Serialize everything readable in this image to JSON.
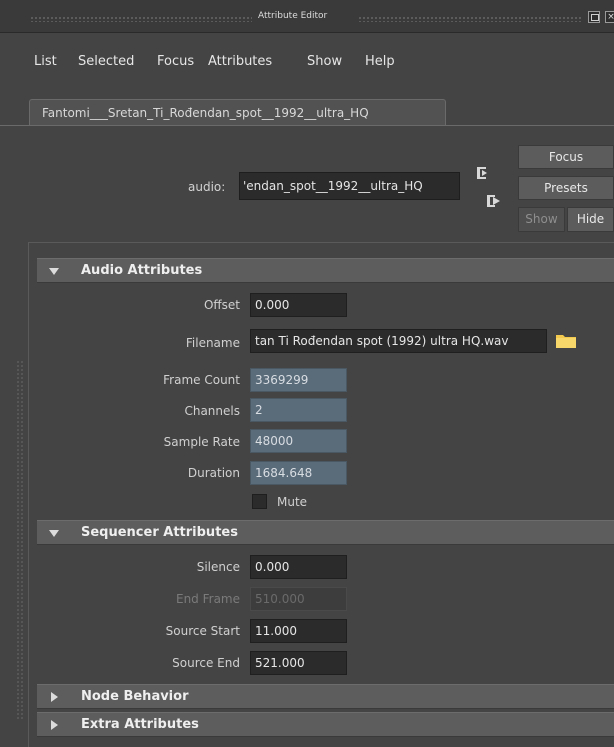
{
  "window": {
    "title": "Attribute Editor"
  },
  "menu": [
    "List",
    "Selected",
    "Focus",
    "Attributes",
    "Show",
    "Help"
  ],
  "tab": {
    "label": "Fantomi___Sretan_Ti_Rođendan_spot__1992__ultra_HQ"
  },
  "node": {
    "label": "audio:",
    "value": "'endan_spot__1992__ultra_HQ"
  },
  "buttons": {
    "focus": "Focus",
    "presets": "Presets",
    "show": "Show",
    "hide": "Hide"
  },
  "sections": {
    "audio": {
      "title": "Audio Attributes",
      "offset": {
        "label": "Offset",
        "value": "0.000"
      },
      "filename": {
        "label": "Filename",
        "value": "tan Ti Rođendan spot (1992) ultra HQ.wav"
      },
      "frame_count": {
        "label": "Frame Count",
        "value": "3369299"
      },
      "channels": {
        "label": "Channels",
        "value": "2"
      },
      "sample_rate": {
        "label": "Sample Rate",
        "value": "48000"
      },
      "duration": {
        "label": "Duration",
        "value": "1684.648"
      },
      "mute": {
        "label": "Mute",
        "checked": false
      }
    },
    "sequencer": {
      "title": "Sequencer Attributes",
      "silence": {
        "label": "Silence",
        "value": "0.000"
      },
      "end_frame": {
        "label": "End Frame",
        "value": "510.000"
      },
      "source_start": {
        "label": "Source Start",
        "value": "11.000"
      },
      "source_end": {
        "label": "Source End",
        "value": "521.000"
      }
    },
    "node_behavior": {
      "title": "Node Behavior"
    },
    "extra": {
      "title": "Extra Attributes"
    }
  },
  "icons": {
    "input_connection": "input-arrow-icon",
    "output_connection": "output-arrow-icon",
    "browse": "folder-icon",
    "expanded": "triangle-down-icon",
    "collapsed": "triangle-right-icon"
  },
  "colors": {
    "background": "#444444",
    "field_edit": "#2b2b2b",
    "field_readonly": "#5a6b7a",
    "section_header": "#5d5d5d",
    "folder": "#f2c94c"
  }
}
